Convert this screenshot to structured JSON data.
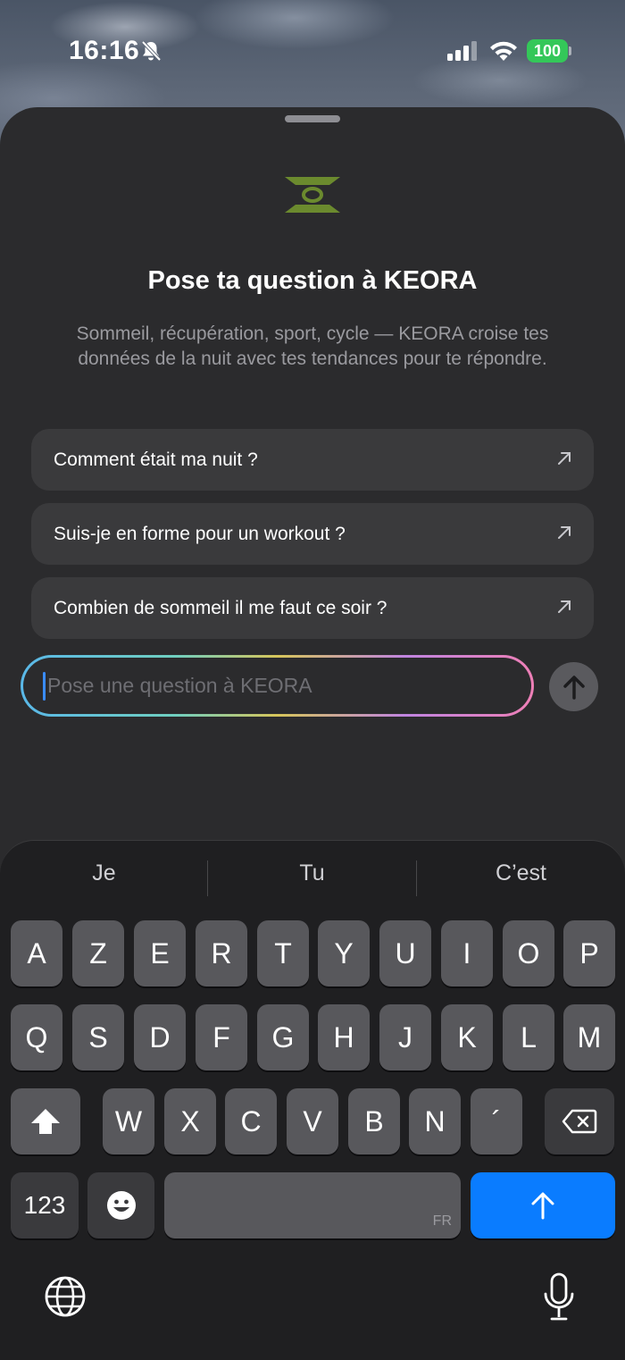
{
  "status_bar": {
    "time": "16:16",
    "battery": "100",
    "battery_color": "#34c759"
  },
  "sheet": {
    "title": "Pose ta question à KEORA",
    "subtitle": "Sommeil, récupération, sport, cycle — KEORA croise tes données de la nuit avec tes tendances pour te répondre.",
    "logo_color": "#6b8a2e",
    "suggestions": [
      {
        "label": "Comment était ma nuit ?"
      },
      {
        "label": "Suis-je en forme pour un workout ?"
      },
      {
        "label": "Combien de sommeil il me faut ce soir ?"
      }
    ]
  },
  "input": {
    "placeholder": "Pose une question à KEORA",
    "value": ""
  },
  "keyboard": {
    "predictions": [
      "Je",
      "Tu",
      "C’est"
    ],
    "row1": [
      "A",
      "Z",
      "E",
      "R",
      "T",
      "Y",
      "U",
      "I",
      "O",
      "P"
    ],
    "row2": [
      "Q",
      "S",
      "D",
      "F",
      "G",
      "H",
      "J",
      "K",
      "L",
      "M"
    ],
    "row3": [
      "W",
      "X",
      "C",
      "V",
      "B",
      "N",
      "´"
    ],
    "numbers_label": "123",
    "space_language": "FR",
    "accent_color": "#0a7cff"
  }
}
